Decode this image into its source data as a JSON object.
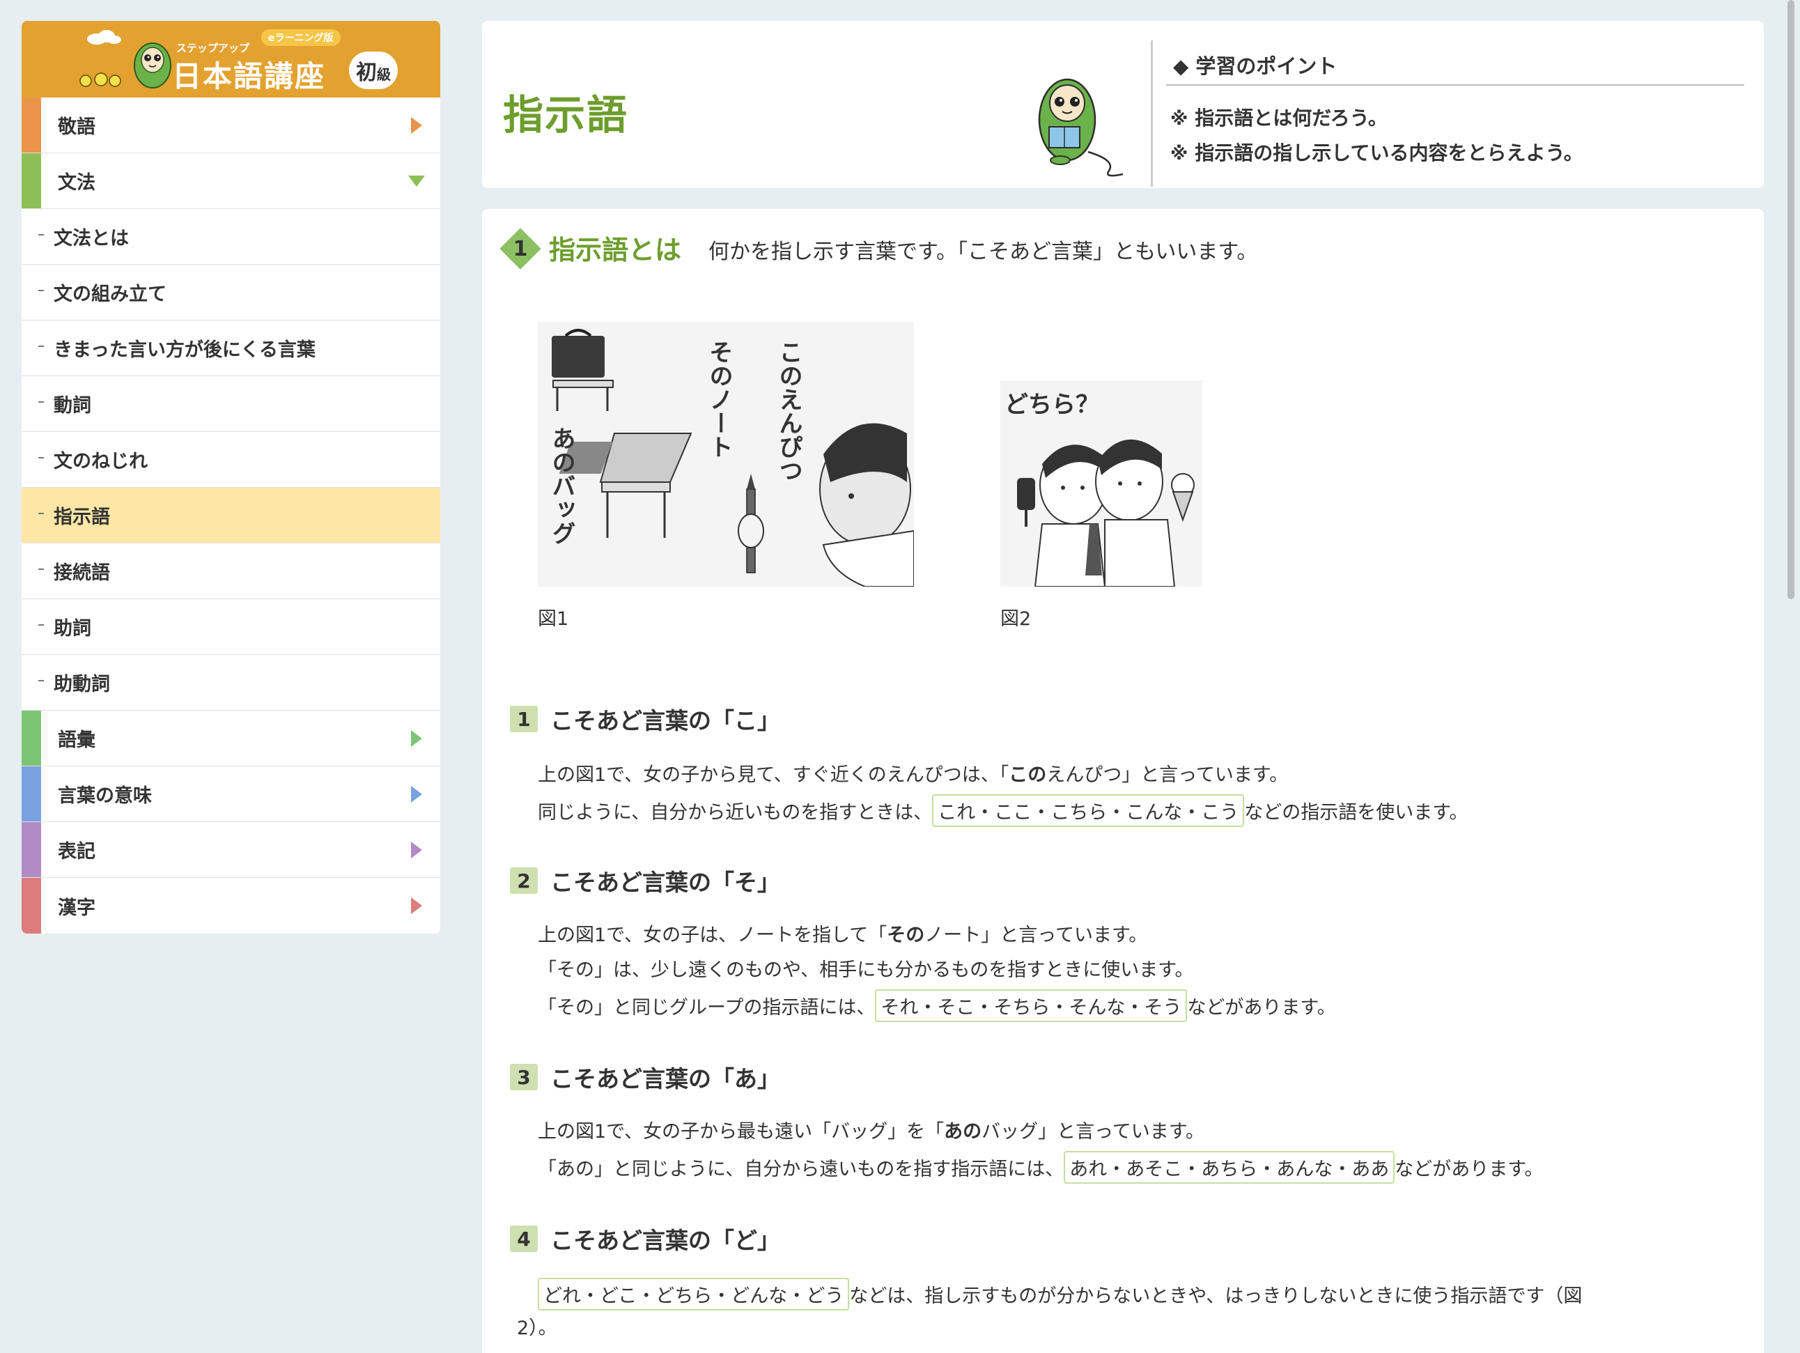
{
  "logo": {
    "subtitle": "ステップアップ",
    "edition_badge": "eラーニング版",
    "title": "日本語講座",
    "level_big": "初",
    "level_small": "級"
  },
  "sidebar": {
    "items": [
      {
        "label": "敬語",
        "type": "category",
        "color": "#e9944a",
        "arrow": "right"
      },
      {
        "label": "文法",
        "type": "category",
        "color": "#8cbf55",
        "arrow": "down"
      },
      {
        "label": "文法とは",
        "type": "sub"
      },
      {
        "label": "文の組み立て",
        "type": "sub"
      },
      {
        "label": "きまった言い方が後にくる言葉",
        "type": "sub"
      },
      {
        "label": "動詞",
        "type": "sub"
      },
      {
        "label": "文のねじれ",
        "type": "sub"
      },
      {
        "label": "指示語",
        "type": "sub",
        "active": true
      },
      {
        "label": "接続語",
        "type": "sub"
      },
      {
        "label": "助詞",
        "type": "sub"
      },
      {
        "label": "助動詞",
        "type": "sub"
      },
      {
        "label": "語彙",
        "type": "category",
        "color": "#7cc575",
        "arrow": "right"
      },
      {
        "label": "言葉の意味",
        "type": "category",
        "color": "#7ba2e0",
        "arrow": "right"
      },
      {
        "label": "表記",
        "type": "category",
        "color": "#b28bc6",
        "arrow": "right"
      },
      {
        "label": "漢字",
        "type": "category",
        "color": "#dd7c7c",
        "arrow": "right"
      }
    ]
  },
  "header": {
    "title": "指示語",
    "points_title": "◆ 学習のポイント",
    "points": [
      "指示語とは何だろう。",
      "指示語の指し示している内容をとらえよう。"
    ],
    "point_mark": "※"
  },
  "section": {
    "number": "1",
    "heading": "指示語とは",
    "description": "何かを指し示す言葉です。「こそあど言葉」ともいいます。",
    "figure1": {
      "caption": "図1",
      "text_kono": "このえんぴつ",
      "text_sono": "そのノート",
      "text_ano": "あのバッグ"
    },
    "figure2": {
      "caption": "図2",
      "text": "どちら？"
    }
  },
  "subsections": [
    {
      "num": "1",
      "title": "こそあど言葉の「こ」",
      "lines": [
        {
          "pre": "上の図1で、女の子から見て、すぐ近くのえんぴつは、「",
          "bold": "この",
          "post": "えんぴつ」と言っています。"
        },
        {
          "pre": "同じように、自分から近いものを指すときは、",
          "hl": "これ・ここ・こちら・こんな・こう",
          "post": "などの指示語を使います。"
        }
      ]
    },
    {
      "num": "2",
      "title": "こそあど言葉の「そ」",
      "lines": [
        {
          "pre": "上の図1で、女の子は、ノートを指して「",
          "bold": "その",
          "post": "ノート」と言っています。"
        },
        {
          "pre": "「その」は、少し遠くのものや、相手にも分かるものを指すときに使います。"
        },
        {
          "pre": "「その」と同じグループの指示語には、",
          "hl": "それ・そこ・そちら・そんな・そう",
          "post": "などがあります。"
        }
      ]
    },
    {
      "num": "3",
      "title": "こそあど言葉の「あ」",
      "lines": [
        {
          "pre": "上の図1で、女の子から最も遠い「バッグ」を「",
          "bold": "あの",
          "post": "バッグ」と言っています。"
        },
        {
          "pre": "「あの」と同じように、自分から遠いものを指す指示語には、",
          "hl": "あれ・あそこ・あちら・あんな・ああ",
          "post": "などがあります。"
        }
      ]
    },
    {
      "num": "4",
      "title": "こそあど言葉の「ど」",
      "lines": [
        {
          "pre": "",
          "hl": "どれ・どこ・どちら・どんな・どう",
          "post": "などは、指し示すものが分からないときや、はっきりしないときに使う指示語です（図"
        },
        {
          "pre": "2）。"
        }
      ]
    }
  ]
}
